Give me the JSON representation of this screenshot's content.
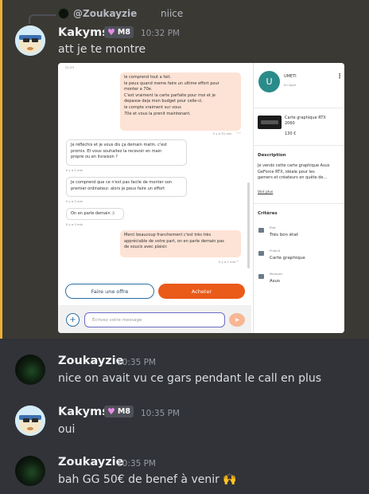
{
  "reply": {
    "username": "@Zoukayzie",
    "text": "niice"
  },
  "messages": [
    {
      "author": "Kakyms",
      "badge": "M8",
      "time": "10:32 PM",
      "text": "att je te montre"
    },
    {
      "author": "Zoukayzie",
      "time": "10:35 PM",
      "text": "nice on avait vu ce gars pendant le call en plus"
    },
    {
      "author": "Kakyms",
      "badge": "M8",
      "time": "10:35 PM",
      "text": "oui"
    },
    {
      "author": "Zoukayzie",
      "time": "10:35 PM",
      "text": "bah GG 50€ de benef à venir 🙌"
    }
  ],
  "attachment": {
    "status_time": "21:23",
    "chat": {
      "bubbles": [
        {
          "side": "out",
          "lines": [
            "le comprend tout a fait.",
            "le peux quand meme faire un ultime effort pour",
            "monter a 70e.",
            "C'est vraiment la carte parfaite pour moi et je",
            "depasse deja mon budget pour celle-ci.",
            "le compte vraiment sur vous",
            "70e et vous la prenit maintenant."
          ],
          "meta": "il y a 31 min"
        },
        {
          "side": "in",
          "lines": [
            "Je réfléchis et je vous dis ça demain matin. c'est",
            "promis. Et vous souhaitez la recevoir en main",
            "propre ou en livraison ?"
          ],
          "meta": "Il y a 2 min"
        },
        {
          "side": "in",
          "lines": [
            "Je comprend que ce n'est pas facile de monter son",
            "premier ordinateur. alors je peux faire un effort"
          ],
          "meta": "Il y a 2 min"
        },
        {
          "side": "in",
          "lines": [
            "On en parle demain :)"
          ],
          "meta": "Il y a 2 min"
        },
        {
          "side": "out",
          "lines": [
            "Merci beaucoup franchement c'est très très",
            "appréciable de votre part, on en parle demain pas",
            "de soucis avec plaisir."
          ],
          "meta": "Il y a 1 min"
        }
      ],
      "offer_button": "Faire une offre",
      "buy_button": "Acheter",
      "input_placeholder": "Écrivez votre message"
    },
    "seller": {
      "initial": "U",
      "name": "UMETI",
      "status": "En ligne"
    },
    "product": {
      "title_lines": [
        "Carte graphique RTX",
        "2060"
      ],
      "price": "130 €"
    },
    "description": {
      "heading": "Description",
      "lines": [
        "Je vends cette carte graphique Asus",
        "GeForce RTX, idéale pour les",
        "gamers et créateurs en quête de..."
      ],
      "more": "Voir plus"
    },
    "criteria": {
      "heading": "Critères",
      "items": [
        {
          "label": "État",
          "value": "Très bon état"
        },
        {
          "label": "Produit",
          "value": "Carte graphique"
        },
        {
          "label": "Marques",
          "value": "Asus"
        }
      ]
    }
  }
}
